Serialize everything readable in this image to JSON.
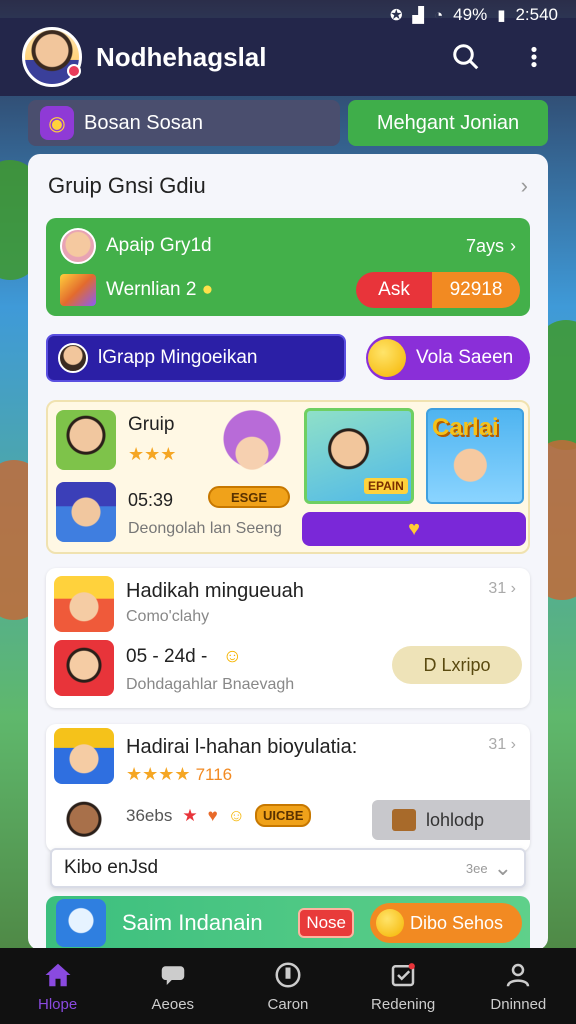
{
  "status_bar": {
    "battery": "49%",
    "time": "2:540"
  },
  "header": {
    "title": "Nodhehagslal"
  },
  "quick_actions": {
    "left_label": "Bosan Sosan",
    "right_label": "Mehgant Jonian"
  },
  "panel": {
    "title": "Gruip Gnsi Gdiu"
  },
  "green_card": {
    "row1_label": "Apaip Gry1d",
    "row1_right": "7ays",
    "row2_label": "Wernlian 2",
    "row2_coin": "●",
    "split_left": "Ask",
    "split_right": "92918"
  },
  "pill_row": {
    "blue_label": "lGrapp Mingoeikan",
    "purple_label": "Vola Saeen"
  },
  "featured": {
    "title": "Gruip",
    "stars": "★★★",
    "time": "05:39",
    "subtitle": "Deongolah lan Seeng",
    "tag": "ESGE",
    "img1_label": "EPAIN",
    "img2_label": "Carlai",
    "bar_icon": "♥"
  },
  "list_cards": [
    {
      "title": "Hadikah mingueuah",
      "count": "31",
      "subtitle": "Como'clahy",
      "row_text": "05 - 24d -",
      "row_icon": "☺",
      "bottom_text": "Dohdagahlar Bnaevagh",
      "button": "D  Lxripo"
    },
    {
      "title": "Hadirai l-hahan bioyulatia:",
      "count": "31",
      "stars": "★★★★",
      "stars_num": "7116",
      "row_text": "36ebs",
      "row_tag": "UICBE",
      "gray_button": "lohlodp"
    }
  ],
  "sub_input": {
    "value": "Kibo enJsd",
    "selector": "3ee"
  },
  "promo": {
    "text": "Saim Indanain",
    "tag": "Nose",
    "button": "Dibo Sehos"
  },
  "bottom_nav": [
    {
      "label": "Hlope",
      "icon": "home-icon",
      "active": true
    },
    {
      "label": "Aeoes",
      "icon": "chat-icon",
      "active": false
    },
    {
      "label": "Caron",
      "icon": "badge-icon",
      "active": false
    },
    {
      "label": "Redening",
      "icon": "inbox-icon",
      "active": false
    },
    {
      "label": "Dninned",
      "icon": "user-icon",
      "active": false
    }
  ]
}
